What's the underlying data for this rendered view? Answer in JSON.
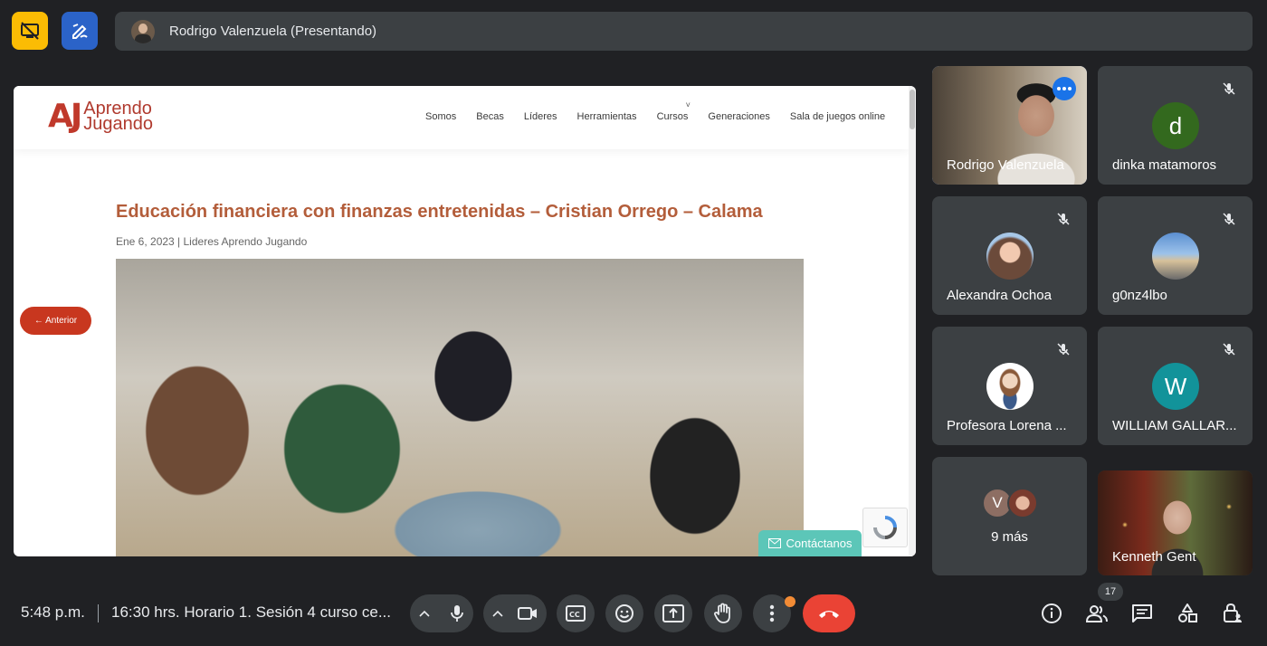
{
  "topbar": {
    "presenter_label": "Rodrigo Valenzuela (Presentando)"
  },
  "shared_site": {
    "logo_mark": "AJ",
    "logo_line1": "Aprendo",
    "logo_line2": "Jugando",
    "nav": [
      "Somos",
      "Becas",
      "Líderes",
      "Herramientas",
      "Cursos",
      "Generaciones",
      "Sala de juegos online"
    ],
    "article_title": "Educación financiera con finanzas entretenidas – Cristian Orrego – Calama",
    "article_meta": "Ene 6, 2023 | Lideres Aprendo Jugando",
    "prev_label": "← Anterior",
    "contact_label": "Contáctanos"
  },
  "participants": [
    {
      "name": "Rodrigo Valenzuela",
      "type": "video",
      "active": true
    },
    {
      "name": "dinka matamoros",
      "initial": "d",
      "color": "#2e7d32",
      "muted": true
    },
    {
      "name": "Alexandra Ochoa",
      "type": "photo",
      "muted": true
    },
    {
      "name": "g0nz4lbo",
      "type": "photo",
      "muted": true
    },
    {
      "name": "Profesora Lorena ...",
      "type": "photo",
      "muted": true
    },
    {
      "name": "WILLIAM GALLAR...",
      "initial": "W",
      "color": "#12939a",
      "muted": true
    },
    {
      "name": "9 más",
      "initial": "V",
      "color": "#8d6e63"
    },
    {
      "name": "Kenneth Gent",
      "type": "video"
    }
  ],
  "bottombar": {
    "time": "5:48 p.m.",
    "meeting_title": "16:30 hrs. Horario 1. Sesión 4 curso ce...",
    "people_count": "17"
  },
  "colors": {
    "background": "#202124",
    "tile": "#3c4043",
    "accent_blue": "#8ab4f8",
    "end_call": "#ea4335",
    "brand_red": "#c0392b"
  }
}
